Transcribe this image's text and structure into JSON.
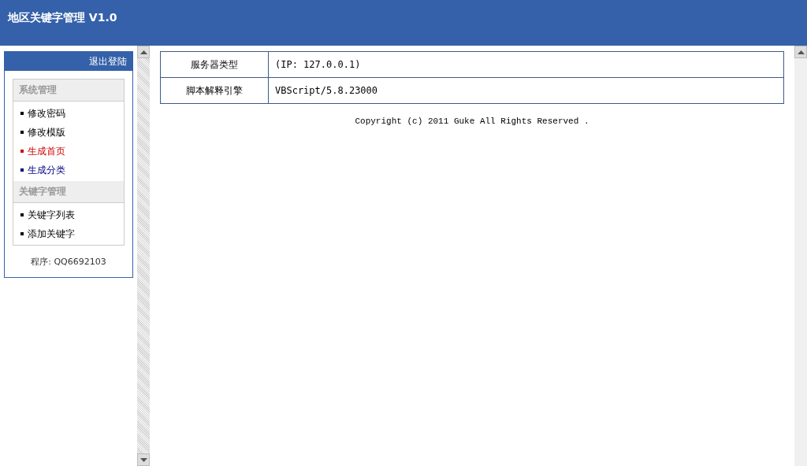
{
  "header": {
    "title": "地区关键字管理 V1.0"
  },
  "sidebar": {
    "logout": "退出登陆",
    "sections": [
      {
        "title": "系统管理",
        "items": [
          {
            "label": "修改密码",
            "color": "#000000"
          },
          {
            "label": "修改模版",
            "color": "#000000"
          },
          {
            "label": "生成首页",
            "color": "#cc0000"
          },
          {
            "label": "生成分类",
            "color": "#000080"
          }
        ]
      },
      {
        "title": "关键字管理",
        "items": [
          {
            "label": "关键字列表",
            "color": "#000000"
          },
          {
            "label": "添加关键字",
            "color": "#000000"
          }
        ]
      }
    ],
    "footer": "程序: QQ6692103"
  },
  "info_table": {
    "rows": [
      {
        "label": "服务器类型",
        "value": "(IP: 127.0.0.1)"
      },
      {
        "label": "脚本解释引擎",
        "value": "VBScript/5.8.23000"
      }
    ]
  },
  "copyright": "Copyright (c) 2011 Guke All Rights Reserved ."
}
